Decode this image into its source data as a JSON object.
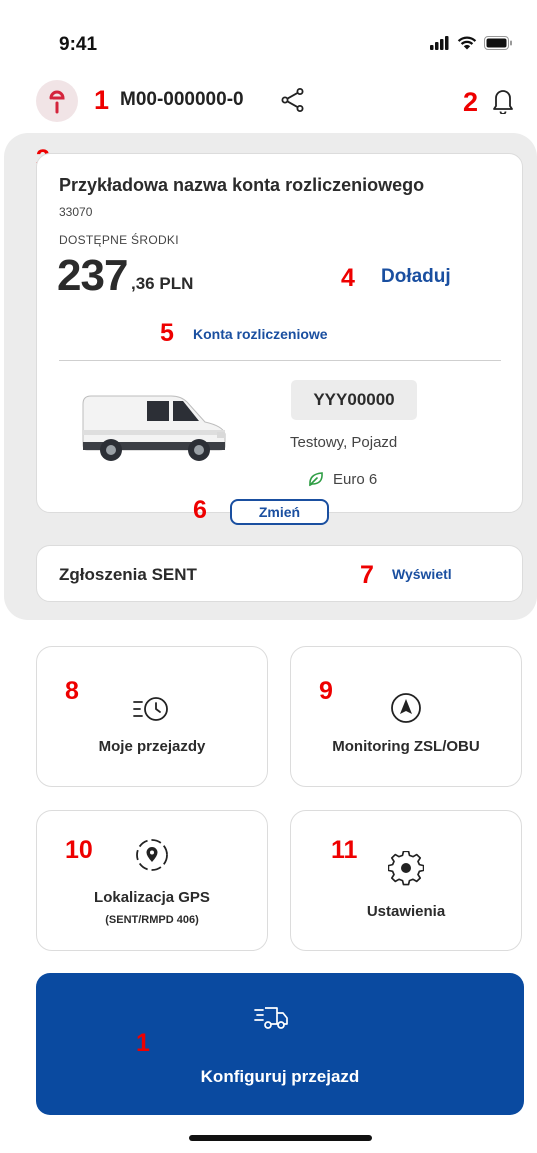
{
  "status_bar": {
    "time": "9:41"
  },
  "header": {
    "account_id": "M00-000000-0"
  },
  "markers": {
    "m1": "1",
    "m2": "2",
    "m3": "3",
    "m4": "4",
    "m5": "5",
    "m6": "6",
    "m7": "7",
    "m8": "8",
    "m9": "9",
    "m10": "10",
    "m11": "11",
    "m1b": "1"
  },
  "account": {
    "name": "Przykładowa nazwa konta rozliczeniowego",
    "number": "33070",
    "funds_label": "DOSTĘPNE ŚRODKI",
    "funds_main": "237",
    "funds_cents": ",36 PLN",
    "topup_label": "Doładuj",
    "accounts_link": "Konta rozliczeniowe"
  },
  "vehicle": {
    "plate": "YYY00000",
    "name": "Testowy, Pojazd",
    "emission": "Euro 6",
    "change_label": "Zmień"
  },
  "sent": {
    "title": "Zgłoszenia SENT",
    "view_label": "Wyświetl"
  },
  "tiles": {
    "trips": "Moje przejazdy",
    "monitoring": "Monitoring ZSL/OBU",
    "gps": "Lokalizacja GPS",
    "gps_sub": "(SENT/RMPD 406)",
    "settings": "Ustawienia"
  },
  "cta": {
    "label": "Konfiguruj przejazd"
  },
  "colors": {
    "accent": "#1a4fa0",
    "cta_bg": "#0a4aa0",
    "marker": "#e00000",
    "brand": "#d4243c"
  }
}
